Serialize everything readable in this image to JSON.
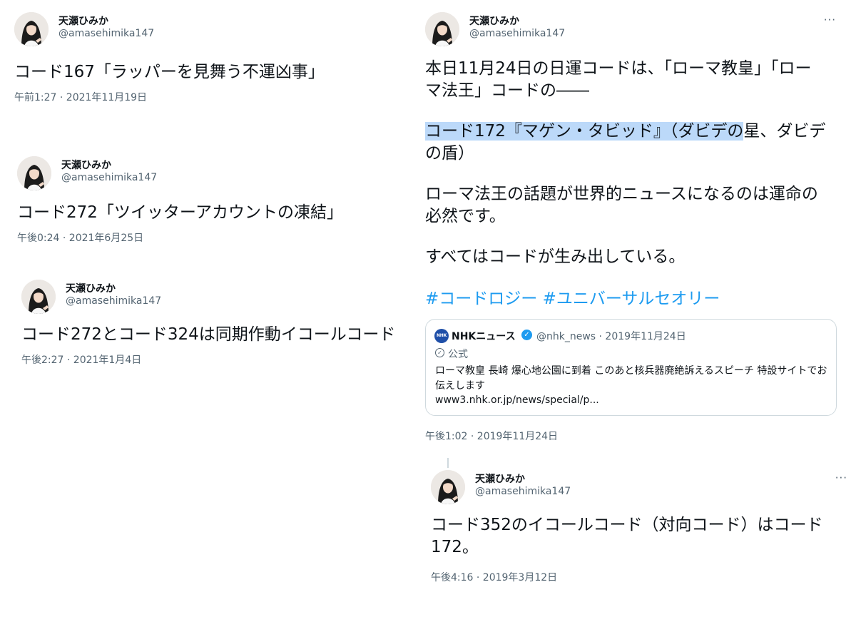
{
  "tweets": [
    {
      "user": "天瀬ひみか",
      "handle": "@amasehimika147",
      "text": "コード167「ラッパーを見舞う不運凶事」",
      "meta": "午前1:27 · 2021年11月19日"
    },
    {
      "user": "天瀬ひみか",
      "handle": "@amasehimika147",
      "text": "コード272「ツイッターアカウントの凍結」",
      "meta": "午後0:24 · 2021年6月25日"
    },
    {
      "user": "天瀬ひみか",
      "handle": "@amasehimika147",
      "text": "コード272とコード324は同期作動イコールコード",
      "meta": "午後2:27 · 2021年1月4日"
    }
  ],
  "main_tweet": {
    "user": "天瀬ひみか",
    "handle": "@amasehimika147",
    "more": "···",
    "line1": "本日11月24日の日運コードは、「ローマ教皇」「ロー",
    "line2": "マ法王」コードの――",
    "line3_highlight": "コード172『マゲン・タビッド』（ダビデの",
    "line3_rest": "星、ダビデ",
    "line4": "の盾）",
    "line5": "ローマ法王の話題が世界的ニュースになるのは運命の",
    "line6": "必然です。",
    "line7": "すべてはコードが生み出している。",
    "hashtag1": "#コードロジー",
    "hashtag2": "#ユニバーサルセオリー",
    "meta": "午後1:02 · 2019年11月24日",
    "quoted": {
      "logo_text": "NHK NEWS",
      "name": "NHKニュース",
      "verified_mark": "✓",
      "handle_date": "@nhk_news · 2019年11月24日",
      "official_label": "公式",
      "text": "ローマ教皇 長崎 爆心地公園に到着 このあと核兵器廃絶訴えるスピーチ 特設サイトでお伝えします",
      "link": "www3.nhk.or.jp/news/special/p..."
    }
  },
  "reply_tweet": {
    "user": "天瀬ひみか",
    "handle": "@amasehimika147",
    "more": "···",
    "line1": "コード352のイコールコード（対向コード）はコード",
    "line2": "172。",
    "meta": "午後4:16 · 2019年3月12日"
  }
}
